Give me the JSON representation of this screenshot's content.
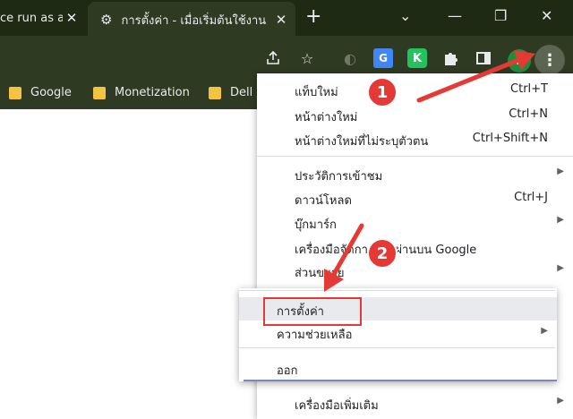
{
  "tabs": [
    {
      "title": "ce run as a",
      "active": false
    },
    {
      "title": "การตั้งค่า - เมื่อเริ่มต้นใช้งาน",
      "active": true
    }
  ],
  "window": {
    "new_tab": "+",
    "minimize": "—",
    "restore": "❐",
    "close": "✕",
    "tab_list": "⌄"
  },
  "toolbar_icons": [
    "share-icon",
    "star-icon",
    "translate-extension-icon",
    "k-extension-icon",
    "puzzle-extension-icon",
    "sidepanel-icon"
  ],
  "extensions": {
    "g_label": "G",
    "k_label": "K"
  },
  "profile": {
    "initial": "P"
  },
  "bookmarks": [
    "Google",
    "Monetization",
    "Dell"
  ],
  "menu": {
    "items": [
      {
        "label": "แท็บใหม่",
        "shortcut": "Ctrl+T"
      },
      {
        "label": "หน้าต่างใหม่",
        "shortcut": "Ctrl+N"
      },
      {
        "label": "หน้าต่างใหม่ที่ไม่ระบุตัวตน",
        "shortcut": "Ctrl+Shift+N"
      },
      {
        "label": "ประวัติการเข้าชม",
        "shortcut": ""
      },
      {
        "label": "ดาวน์โหลด",
        "shortcut": "Ctrl+J"
      },
      {
        "label": "บุ๊กมาร์ก",
        "shortcut": ""
      },
      {
        "label": "เครื่องมือจัดการรหัสผ่านบน Google",
        "shortcut": ""
      },
      {
        "label": "ส่วนขยาย",
        "shortcut": ""
      },
      {
        "label": "เครื่องมือเพิ่มเติม",
        "shortcut": ""
      }
    ]
  },
  "submenu": {
    "settings": "การตั้งค่า",
    "help": "ความช่วยเหลือ",
    "exit": "ออก"
  },
  "annotations": {
    "step1": "1",
    "step2": "2"
  },
  "colors": {
    "accent_red": "#e53935",
    "tabstrip": "#1f2a14",
    "toolbar": "#2f3a22"
  }
}
